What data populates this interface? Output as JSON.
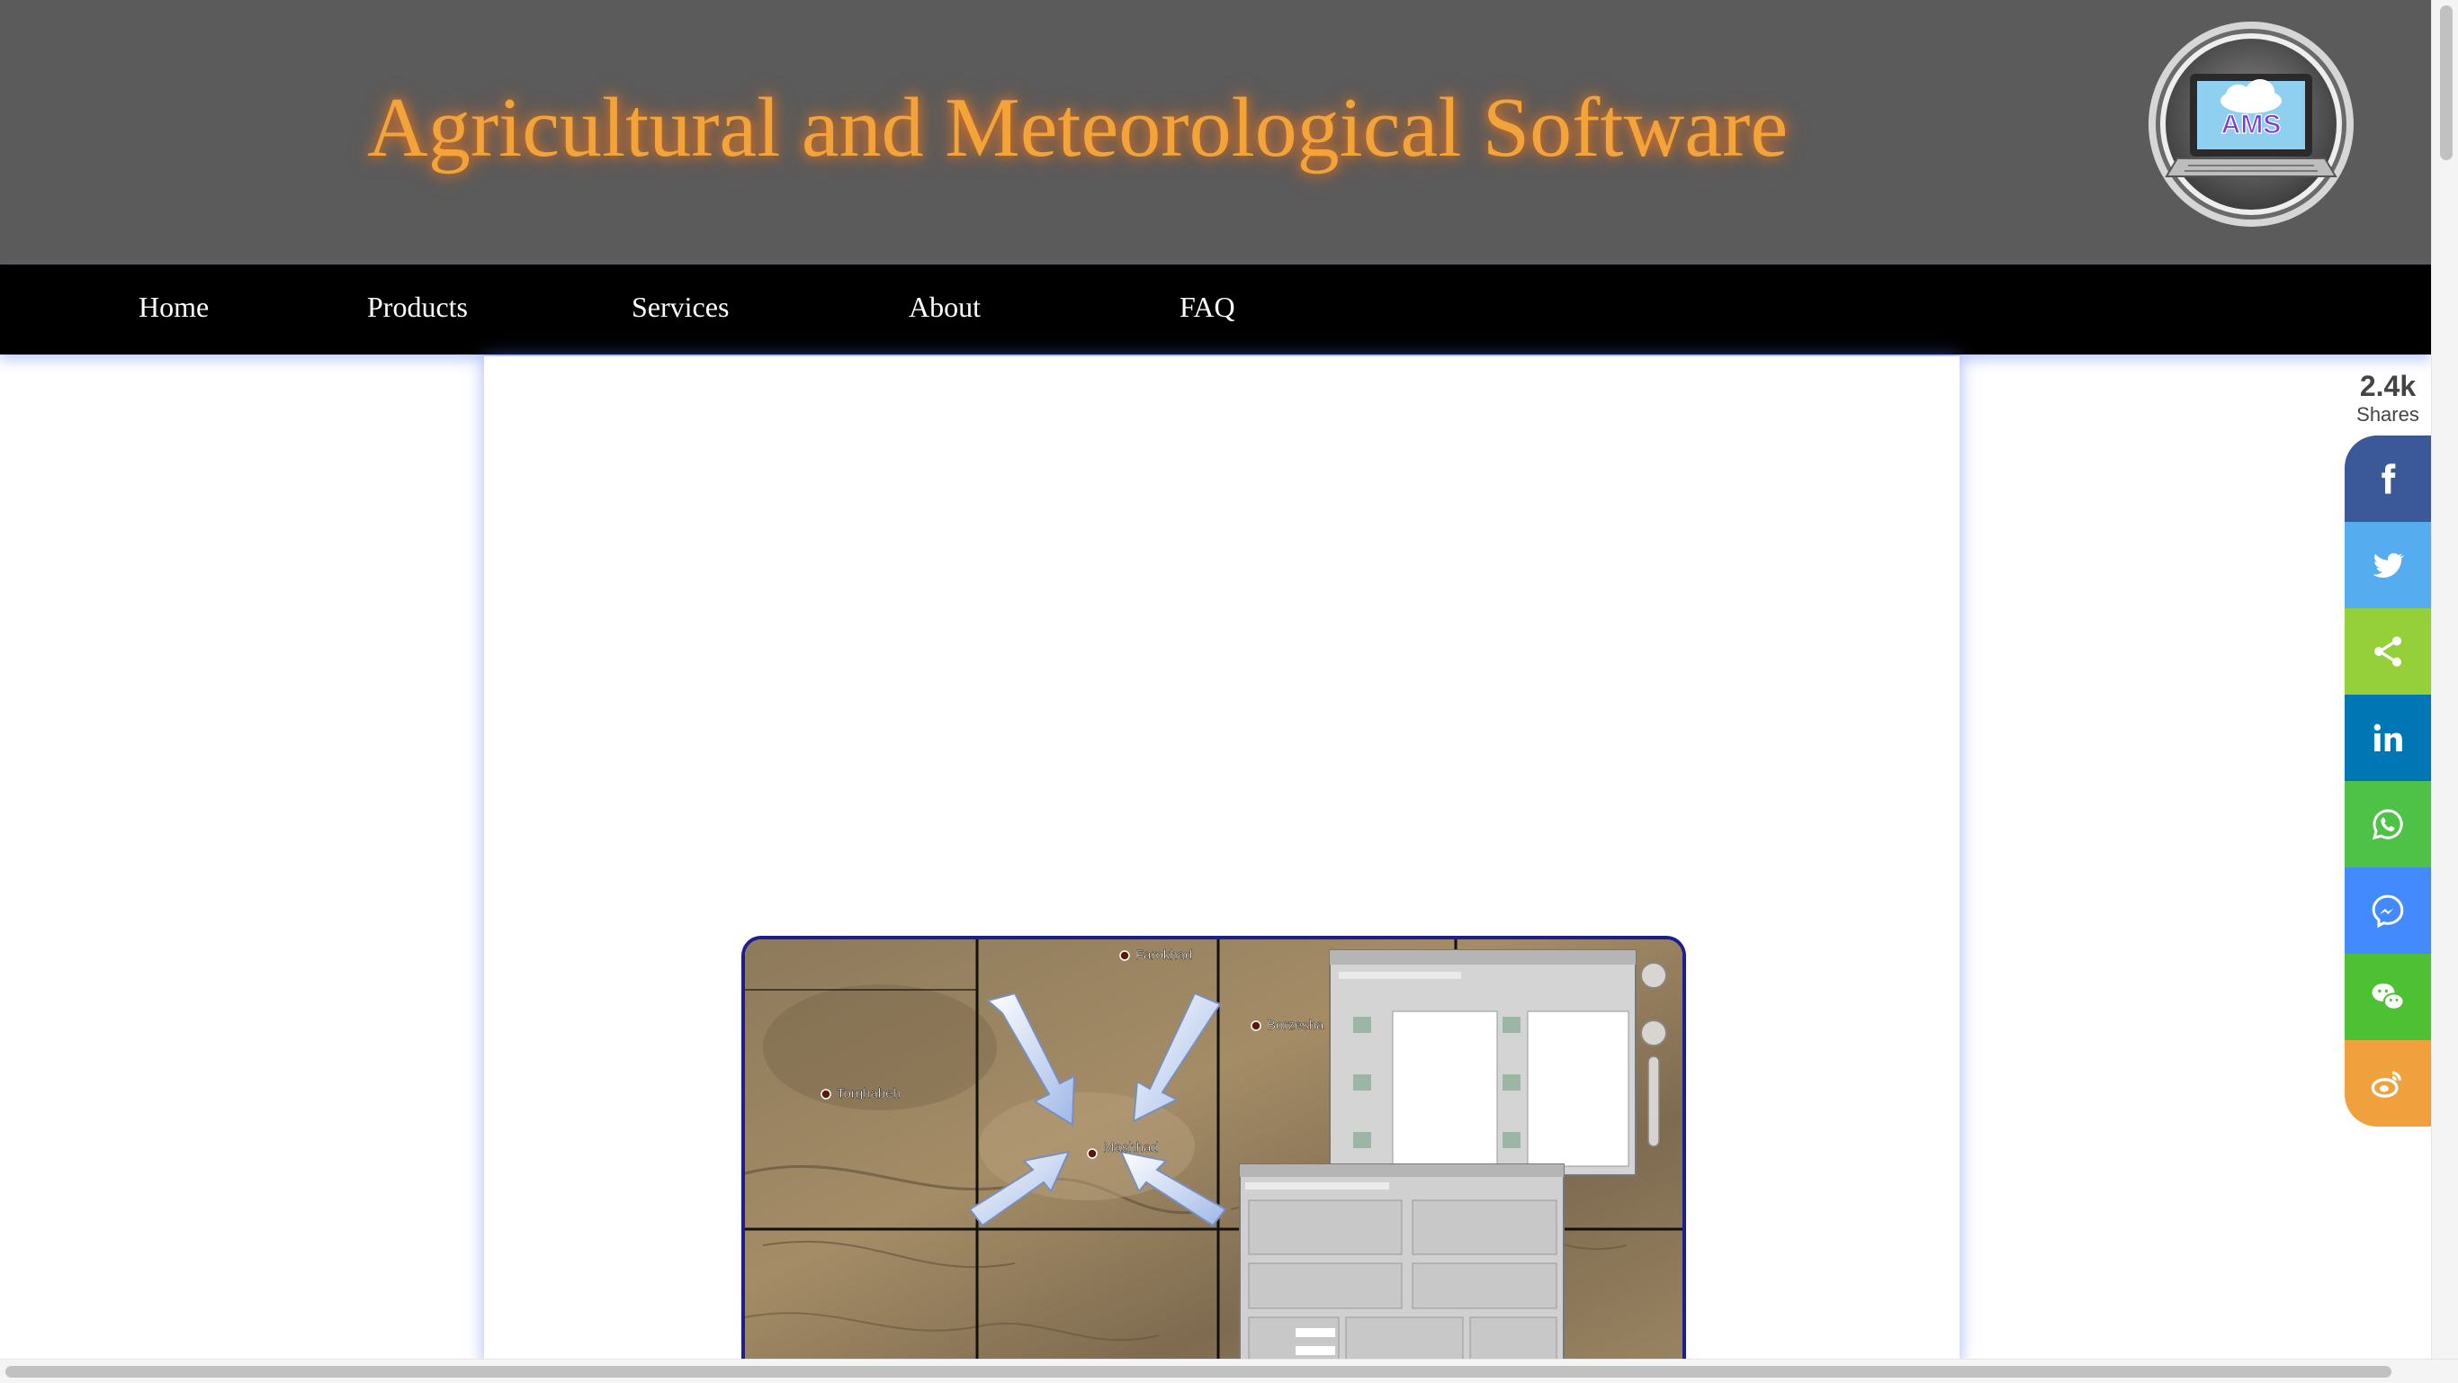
{
  "header": {
    "site_title": "Agricultural and Meteorological Software",
    "logo_text": "AMS"
  },
  "nav": {
    "items": [
      "Home",
      "Products",
      "Services",
      "About",
      "FAQ"
    ]
  },
  "hero": {
    "map_labels": [
      "Farokhad",
      "Borzesha",
      "Torghabeh",
      "Mashhad"
    ]
  },
  "share": {
    "count": "2.4k",
    "label": "Shares",
    "buttons": [
      {
        "name": "facebook",
        "icon": "facebook-icon",
        "color": "#3b5998"
      },
      {
        "name": "twitter",
        "icon": "twitter-icon",
        "color": "#55acee"
      },
      {
        "name": "share",
        "icon": "share-icon",
        "color": "#95d03a"
      },
      {
        "name": "linkedin",
        "icon": "linkedin-icon",
        "color": "#0077b5"
      },
      {
        "name": "whatsapp",
        "icon": "whatsapp-icon",
        "color": "#4dc247"
      },
      {
        "name": "messenger",
        "icon": "messenger-icon",
        "color": "#448aff"
      },
      {
        "name": "wechat",
        "icon": "wechat-icon",
        "color": "#4ec034"
      },
      {
        "name": "weibo",
        "icon": "weibo-icon",
        "color": "#f0a03c"
      }
    ]
  },
  "colors": {
    "header_bg": "#5b5b5b",
    "title": "#f2a33a",
    "nav_bg": "#000000",
    "card_glow": "#5a78ff"
  }
}
